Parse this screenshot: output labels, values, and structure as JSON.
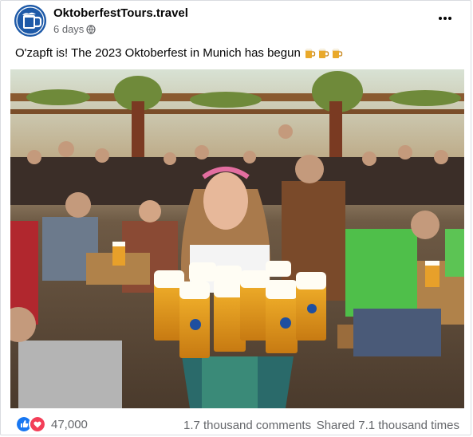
{
  "post": {
    "author": "OktoberfestTours.travel",
    "time": "6 days",
    "audience_icon": "globe-icon",
    "more_icon": "more-options-icon",
    "caption": "O'zapft is! The 2023 Oktoberfest in Munich has begun",
    "caption_emoji": [
      "beer-mug-icon",
      "beer-mug-icon",
      "beer-mug-icon"
    ]
  },
  "photo": {
    "description_icon": "oktoberfest-beer-tent-photo",
    "mug_badge": "HB"
  },
  "footer": {
    "reaction_icons": [
      "like-icon",
      "love-icon"
    ],
    "reaction_count": "47,000",
    "comments": "1.7 thousand comments",
    "shares": "Shared 7.1 thousand times"
  },
  "colors": {
    "like_blue": "#1877f2",
    "love_red": "#f33e58",
    "secondary_text": "#65676b",
    "brand_blue": "#1e5aa8"
  }
}
